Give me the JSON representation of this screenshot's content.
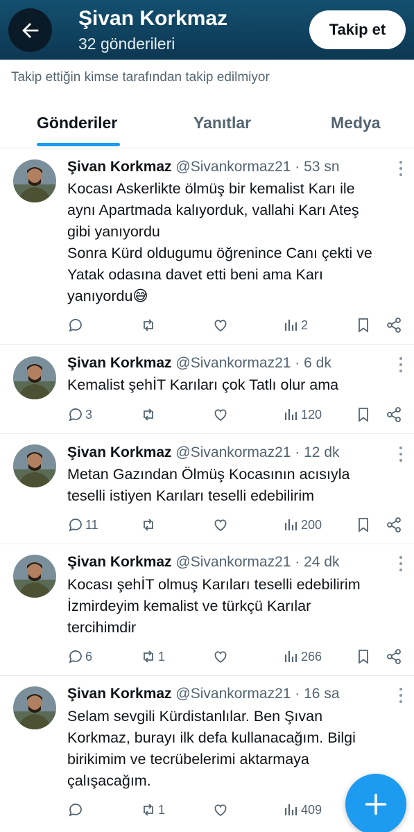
{
  "header": {
    "name": "Şivan Korkmaz",
    "post_count": "32 gönderileri",
    "follow_label": "Takip et",
    "bg_color": "#0d3752"
  },
  "follow_note": "Takip ettiğin kimse tarafından takip edilmiyor",
  "tabs": [
    {
      "label": "Gönderiler",
      "active": true
    },
    {
      "label": "Yanıtlar",
      "active": false
    },
    {
      "label": "Medya",
      "active": false
    }
  ],
  "accent_color": "#1d9bf0",
  "posts": [
    {
      "name": "Şivan Korkmaz",
      "meta": "@Sivankormaz21 · 53 sn",
      "lines": [
        "Kocası Askerlikte ölmüş bir kemalist Karı ile",
        "aynı Apartmada kalıyorduk, vallahi Karı Ateş",
        "gibi yanıyordu",
        "Sonra  Kürd oldugumu öğrenince Canı çekti ve",
        "Yatak odasına davet etti beni ama Karı",
        "yanıyordu😅"
      ],
      "replies": "",
      "reposts": "",
      "likes": "",
      "views": "2"
    },
    {
      "name": "Şivan Korkmaz",
      "meta": "@Sivankormaz21 · 6 dk",
      "lines": [
        "Kemalist şehİT Karıları çok Tatlı olur ama"
      ],
      "replies": "3",
      "reposts": "",
      "likes": "",
      "views": "120"
    },
    {
      "name": "Şivan Korkmaz",
      "meta": "@Sivankormaz21 · 12 dk",
      "lines": [
        "Metan Gazından Ölmüş  Kocasının acısıyla",
        "teselli istiyen Karıları teselli edebilirim"
      ],
      "replies": "11",
      "reposts": "",
      "likes": "",
      "views": "200"
    },
    {
      "name": "Şivan Korkmaz",
      "meta": "@Sivankormaz21 · 24 dk",
      "lines": [
        "Kocası şehİT olmuş Karıları teselli edebilirim",
        "İzmirdeyim kemalist ve türkçü Karılar",
        "tercihimdir"
      ],
      "replies": "6",
      "reposts": "1",
      "likes": "",
      "views": "266"
    },
    {
      "name": "Şivan Korkmaz",
      "meta": "@Sivankormaz21 · 16 sa",
      "lines": [
        "Selam sevgili Kürdistanlılar. Ben Şıvan",
        "Korkmaz, burayı ilk defa kullanacağım. Bilgi",
        "birikimim ve tecrübelerimi aktarmaya",
        "çalışacağım."
      ],
      "replies": "",
      "reposts": "1",
      "likes": "",
      "views": "409"
    }
  ],
  "icons": {
    "back": "arrow-left-icon",
    "reply": "speech-bubble-icon",
    "repost": "repost-arrows-icon",
    "like": "heart-icon",
    "views": "bar-chart-icon",
    "bookmark": "bookmark-icon",
    "share": "share-icon",
    "more": "vertical-dots-icon",
    "compose": "plus-icon"
  }
}
